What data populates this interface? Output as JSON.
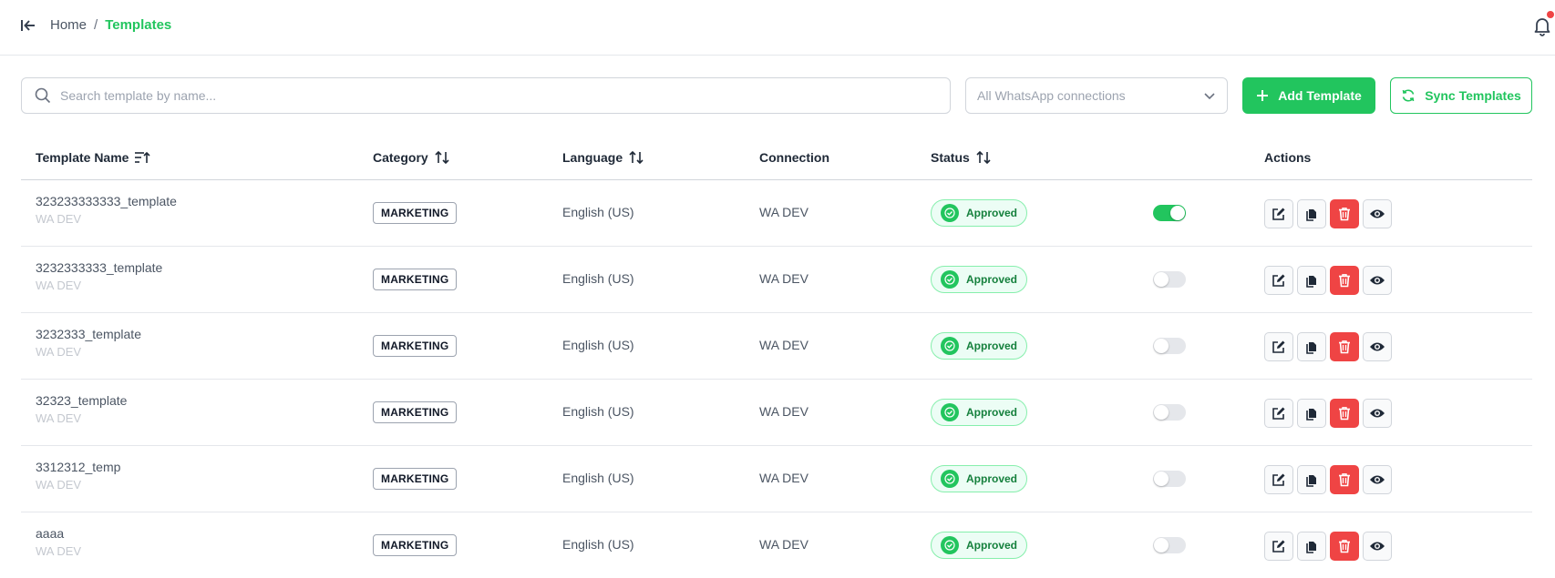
{
  "breadcrumb": {
    "home": "Home",
    "separator": "/",
    "current": "Templates"
  },
  "search": {
    "placeholder": "Search template by name..."
  },
  "connection_filter": {
    "selected": "All WhatsApp connections"
  },
  "buttons": {
    "add": "Add Template",
    "sync": "Sync Templates"
  },
  "colors": {
    "accent": "#22c55e",
    "danger": "#ef4444"
  },
  "table": {
    "headers": {
      "name": "Template Name",
      "category": "Category",
      "language": "Language",
      "connection": "Connection",
      "status": "Status",
      "actions": "Actions"
    },
    "rows": [
      {
        "name": "323233333333_template",
        "sub": "WA DEV",
        "category": "MARKETING",
        "language": "English (US)",
        "connection": "WA DEV",
        "status": "Approved",
        "enabled": true
      },
      {
        "name": "3232333333_template",
        "sub": "WA DEV",
        "category": "MARKETING",
        "language": "English (US)",
        "connection": "WA DEV",
        "status": "Approved",
        "enabled": false
      },
      {
        "name": "3232333_template",
        "sub": "WA DEV",
        "category": "MARKETING",
        "language": "English (US)",
        "connection": "WA DEV",
        "status": "Approved",
        "enabled": false
      },
      {
        "name": "32323_template",
        "sub": "WA DEV",
        "category": "MARKETING",
        "language": "English (US)",
        "connection": "WA DEV",
        "status": "Approved",
        "enabled": false
      },
      {
        "name": "3312312_temp",
        "sub": "WA DEV",
        "category": "MARKETING",
        "language": "English (US)",
        "connection": "WA DEV",
        "status": "Approved",
        "enabled": false
      },
      {
        "name": "aaaa",
        "sub": "WA DEV",
        "category": "MARKETING",
        "language": "English (US)",
        "connection": "WA DEV",
        "status": "Approved",
        "enabled": false
      }
    ]
  },
  "icons": {
    "collapse": "collapse-sidebar-icon",
    "bell": "bell-icon",
    "search": "search-icon",
    "chevron": "chevron-down-icon",
    "add": "plus-icon",
    "sync": "sync-icon",
    "sort": "sort-icon",
    "edit": "edit-icon",
    "copy": "copy-icon",
    "delete": "trash-icon",
    "view": "eye-icon",
    "status": "check-circle-icon"
  }
}
